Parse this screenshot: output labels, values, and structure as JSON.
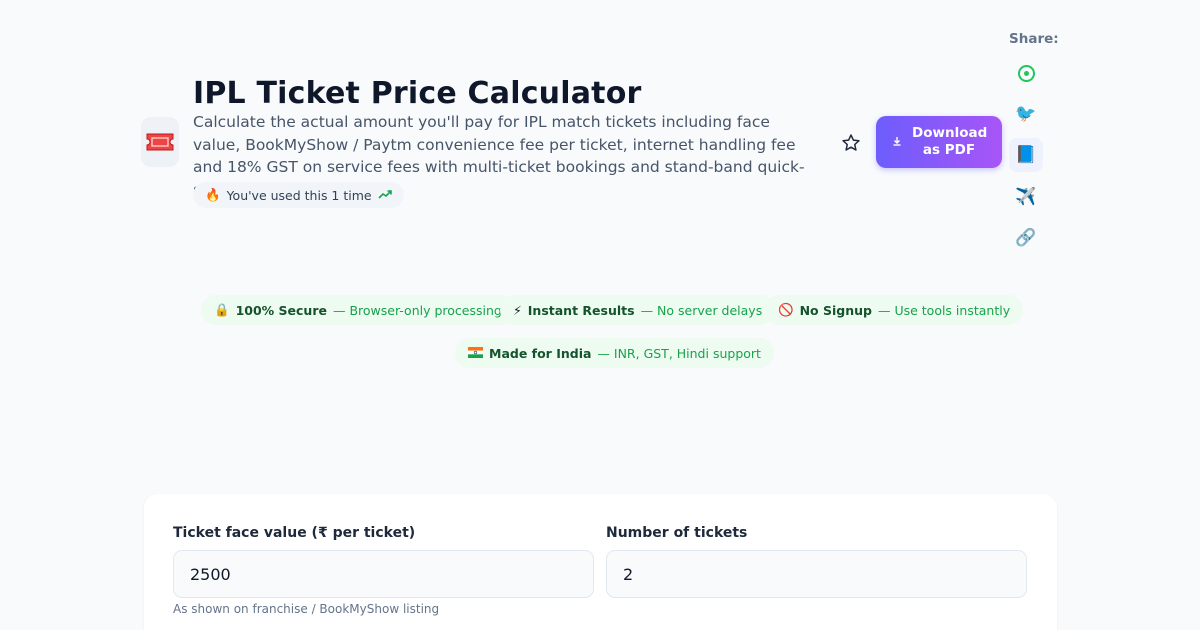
{
  "header": {
    "title": "IPL Ticket Price Calculator",
    "description": "Calculate the actual amount you'll pay for IPL match tickets including face value, BookMyShow / Paytm convenience fee per ticket, internet handling fee and 18% GST on service fees with multi-ticket bookings and stand-band quick-set",
    "tool_icon": "ticket-icon",
    "usage": {
      "emoji": "🔥",
      "text": "You've used this 1 time",
      "trend_icon": "trending-up-icon"
    }
  },
  "actions": {
    "favorite_icon": "star-icon",
    "download_label": "Download as PDF",
    "download_icon": "download-icon"
  },
  "share": {
    "label": "Share:",
    "items": [
      {
        "name": "whatsapp",
        "icon": "whatsapp-icon"
      },
      {
        "name": "twitter",
        "icon": "🐦"
      },
      {
        "name": "facebook",
        "icon": "📘"
      },
      {
        "name": "telegram",
        "icon": "✈️"
      },
      {
        "name": "copy-link",
        "icon": "🔗"
      }
    ]
  },
  "badges": [
    {
      "icon": "🔒",
      "title": "100% Secure",
      "desc": "— Browser-only processing"
    },
    {
      "icon": "⚡",
      "title": "Instant Results",
      "desc": "— No server delays"
    },
    {
      "icon": "🚫",
      "title": "No Signup",
      "desc": "— Use tools instantly"
    },
    {
      "icon": "🇮🇳",
      "title": "Made for India",
      "desc": "— INR, GST, Hindi support"
    }
  ],
  "form": {
    "face_value": {
      "label": "Ticket face value (₹ per ticket)",
      "value": "2500",
      "hint": "As shown on franchise / BookMyShow listing"
    },
    "tickets": {
      "label": "Number of tickets",
      "value": "2"
    }
  },
  "colors": {
    "accent_start": "#6d5dfc",
    "accent_end": "#a855f7",
    "badge_bg": "#eefbf1",
    "badge_text": "#16a34a"
  }
}
